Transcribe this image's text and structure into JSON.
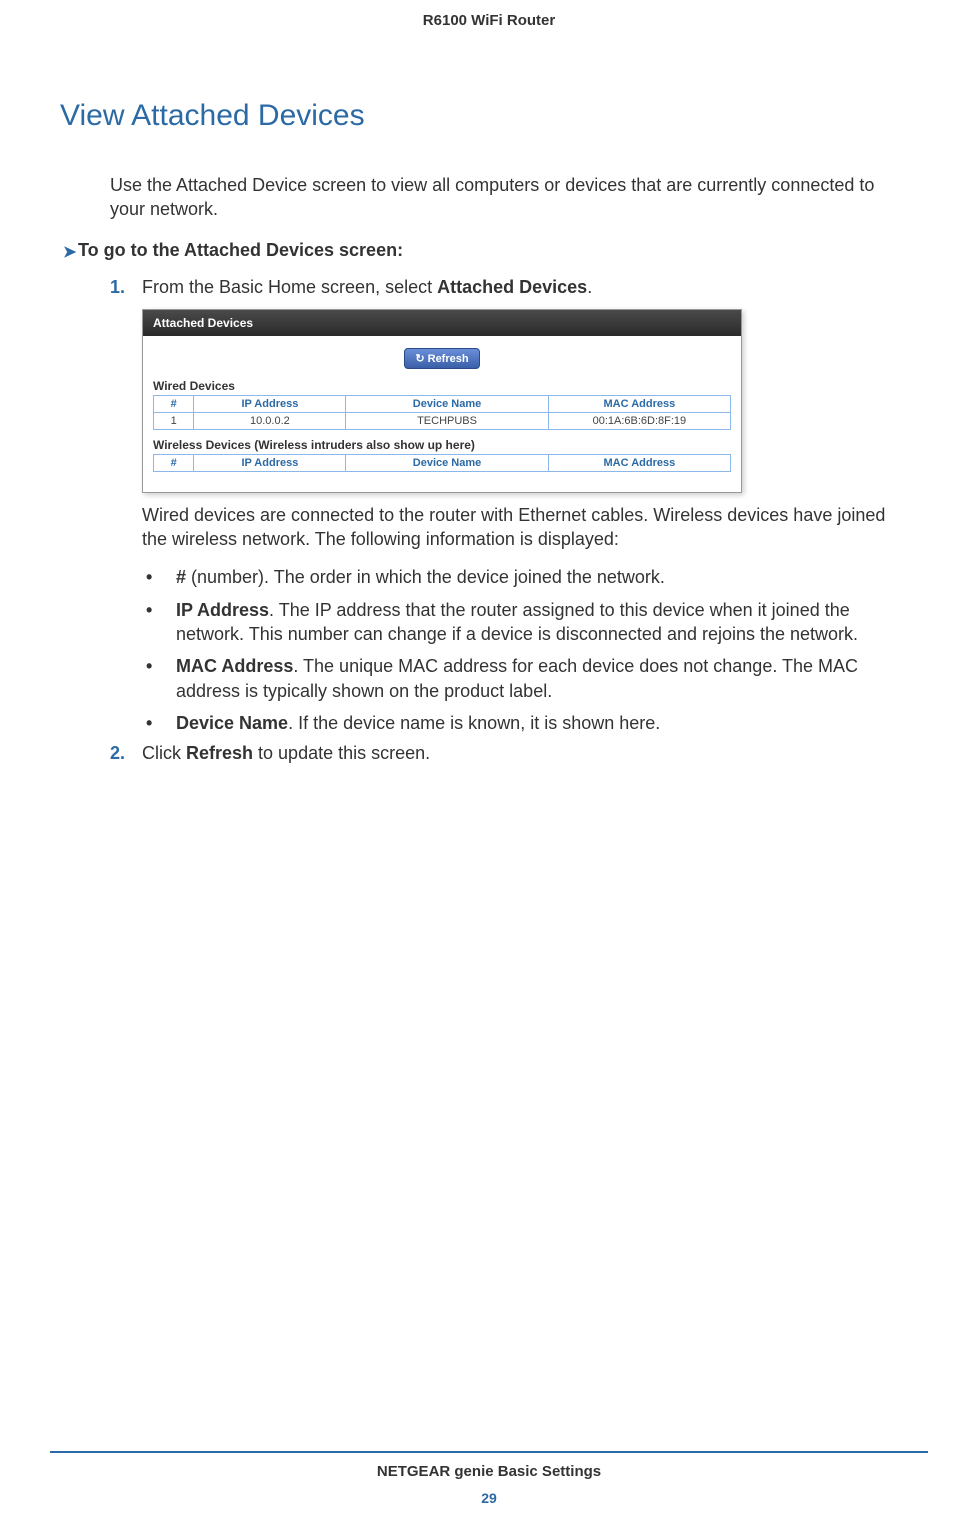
{
  "header": {
    "title": "R6100 WiFi Router"
  },
  "heading": "View Attached Devices",
  "intro": "Use the Attached Device screen to view all computers or devices that are currently connected to your network.",
  "proc_heading": "To go to the Attached Devices screen:",
  "step1": {
    "num": "1.",
    "text_before": "From the Basic Home screen, select ",
    "bold": "Attached Devices",
    "text_after": "."
  },
  "screenshot": {
    "titlebar": "Attached Devices",
    "refresh_label": "Refresh",
    "wired_label": "Wired Devices",
    "wireless_label": "Wireless Devices (Wireless intruders also show up here)",
    "cols": {
      "num": "#",
      "ip": "IP Address",
      "name": "Device Name",
      "mac": "MAC Address"
    },
    "wired_rows": [
      {
        "num": "1",
        "ip": "10.0.0.2",
        "name": "TECHPUBS",
        "mac": "00:1A:6B:6D:8F:19"
      }
    ]
  },
  "desc": "Wired devices are connected to the router with Ethernet cables. Wireless devices have joined the wireless network. The following information is displayed:",
  "bullets": [
    {
      "bold": "#",
      "rest": " (number). The order in which the device joined the network."
    },
    {
      "bold": "IP Address",
      "rest": ". The IP address that the router assigned to this device when it joined the network. This number can change if a device is disconnected and rejoins the network."
    },
    {
      "bold": "MAC Address",
      "rest": ". The unique MAC address for each device does not change. The MAC address is typically shown on the product label."
    },
    {
      "bold": "Device Name",
      "rest": ". If the device name is known, it is shown here."
    }
  ],
  "step2": {
    "num": "2.",
    "text_before": "Click ",
    "bold": "Refresh",
    "text_after": " to update this screen."
  },
  "footer": {
    "title": "NETGEAR genie Basic Settings",
    "page": "29"
  }
}
